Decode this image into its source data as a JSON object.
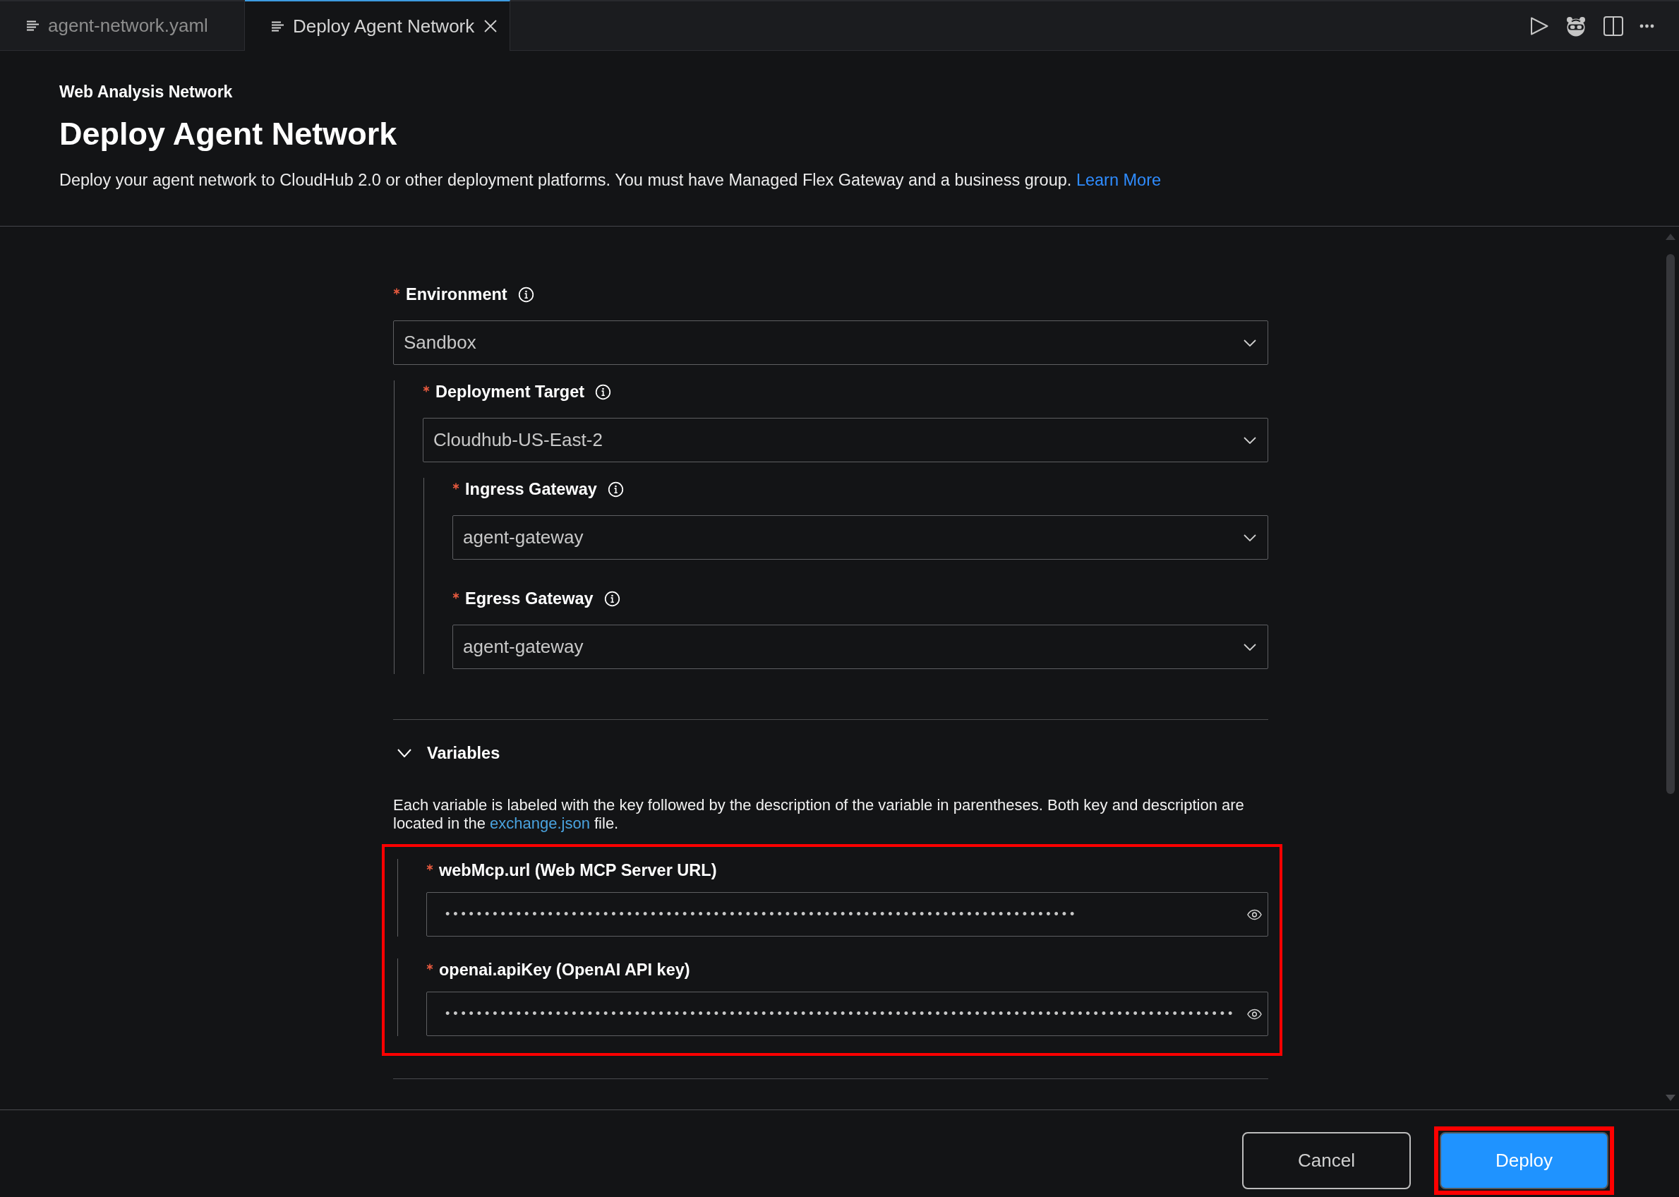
{
  "tabs": [
    {
      "label": "agent-network.yaml",
      "selected": false
    },
    {
      "label": "Deploy Agent Network",
      "selected": true
    }
  ],
  "header": {
    "network_name": "Web Analysis Network",
    "title": "Deploy Agent Network",
    "description": "Deploy your agent network to CloudHub 2.0 or other deployment platforms. You must have Managed Flex Gateway and a business group. ",
    "link": "Learn More"
  },
  "form": {
    "fields": [
      {
        "label": "Environment",
        "required": true,
        "value": "Sandbox",
        "children": [
          {
            "label": "Deployment Target",
            "required": true,
            "value": "Cloudhub-US-East-2",
            "children": [
              {
                "label": "Ingress Gateway",
                "required": true,
                "value": "agent-gateway"
              },
              {
                "label": "Egress Gateway",
                "required": true,
                "value": "agent-gateway"
              }
            ]
          }
        ]
      }
    ]
  },
  "variables": {
    "title": "Variables",
    "expanded": true,
    "description": "Each variable is labeled with the key followed by the description of the variable in parentheses. Both key and description are located in the ",
    "link": "exchange.json",
    "description_end": " file.",
    "highlighted": true,
    "items": [
      {
        "label": "webMcp.url (Web MCP Server URL)",
        "required": true,
        "value": "••••••••••••••••••••••••••••••••••••••••••••••••••••••••••••••••••••••••••••••••"
      },
      {
        "label": "openai.apiKey (OpenAI API key)",
        "required": true,
        "value": "••••••••••••••••••••••••••••••••••••••••••••••••••••••••••••••••••••••••••••••••••••••••••••••••••••"
      }
    ]
  },
  "footer": {
    "buttons": [
      {
        "label": "Cancel",
        "kind": "secondary",
        "highlighted": false
      },
      {
        "label": "Deploy",
        "kind": "primary",
        "highlighted": true
      }
    ]
  }
}
